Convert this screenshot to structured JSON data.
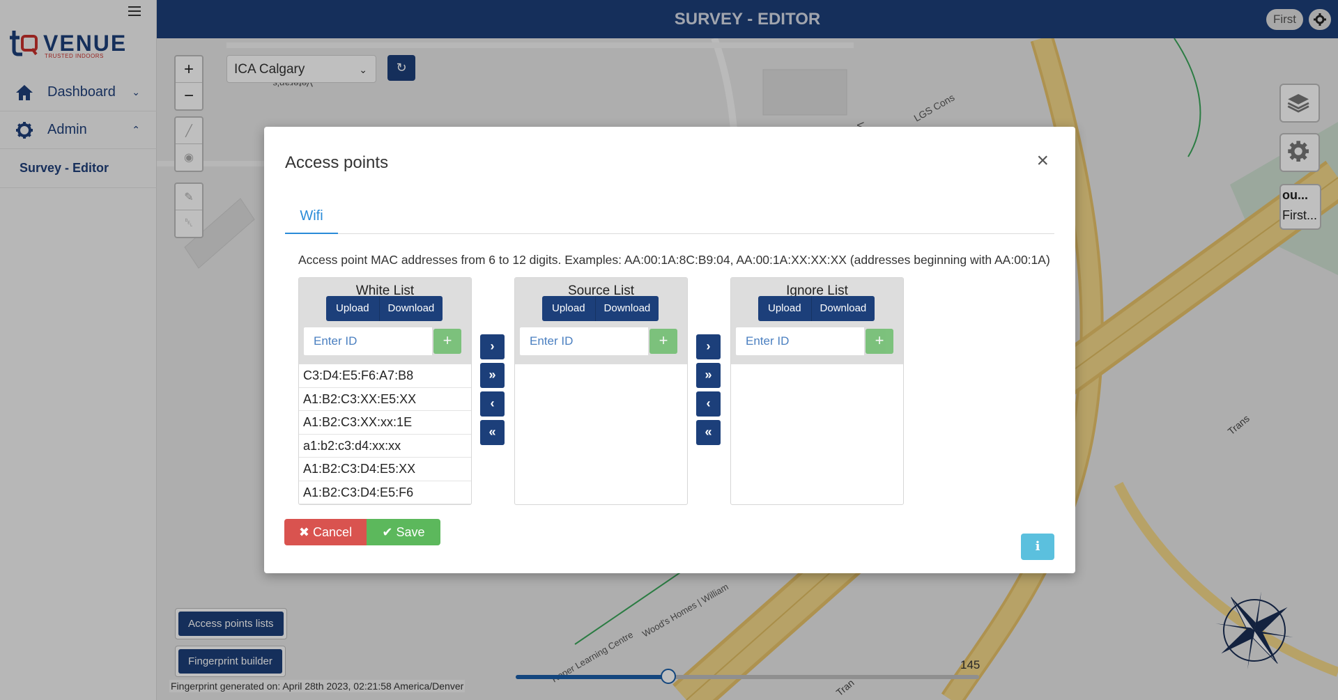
{
  "app": {
    "logo_text": "VENUE",
    "logo_tagline": "TRUSTED INDOORS",
    "header_title": "SURVEY - EDITOR",
    "user_label": "First"
  },
  "sidebar": {
    "items": [
      {
        "label": "Dashboard",
        "icon": "home-icon",
        "chevron": "chevron-down-icon"
      },
      {
        "label": "Admin",
        "icon": "gear-icon",
        "chevron": "chevron-up-icon"
      },
      {
        "label": "Survey - Editor"
      }
    ]
  },
  "map": {
    "floor_select": "ICA Calgary",
    "zoom_in": "+",
    "zoom_out": "−",
    "buttons": [
      "Access points lists",
      "Fingerprint builder"
    ],
    "fingerprint_status": "Fingerprint generated on: April 28th 2023, 02:21:58 America/Denver",
    "slider_max": "145",
    "slider_value_fraction": 0.33,
    "side_panel": [
      "ou...",
      "First..."
    ],
    "labels": [
      "Veteran's",
      "Veter",
      "LGS Cons",
      "Trans",
      "Wood's Homes | William",
      "Roper Learning Centre",
      "Tran"
    ]
  },
  "modal": {
    "title": "Access points",
    "close": "×",
    "tab": "Wifi",
    "description": "Access point MAC addresses from 6 to 12 digits. Examples: AA:00:1A:8C:B9:04, AA:00:1A:XX:XX:XX (addresses beginning with AA:00:1A)",
    "lists": [
      {
        "title": "White List",
        "upload": "Upload",
        "download": "Download",
        "placeholder": "Enter ID",
        "items": [
          "C3:D4:E5:F6:A7:B8",
          "A1:B2:C3:XX:E5:XX",
          "A1:B2:C3:XX:xx:1E",
          "a1:b2:c3:d4:xx:xx",
          "A1:B2:C3:D4:E5:XX",
          "A1:B2:C3:D4:E5:F6"
        ]
      },
      {
        "title": "Source List",
        "upload": "Upload",
        "download": "Download",
        "placeholder": "Enter ID",
        "items": []
      },
      {
        "title": "Ignore List",
        "upload": "Upload",
        "download": "Download",
        "placeholder": "Enter ID",
        "items": []
      }
    ],
    "move_buttons": [
      "›",
      "»",
      "‹",
      "«"
    ],
    "cancel": "Cancel",
    "save": "Save",
    "info": "i",
    "colors": {
      "primary": "#1c3f7a",
      "danger": "#d9534f",
      "success": "#5cb85c",
      "info": "#5bc0de",
      "tab": "#2a8bd8"
    }
  }
}
